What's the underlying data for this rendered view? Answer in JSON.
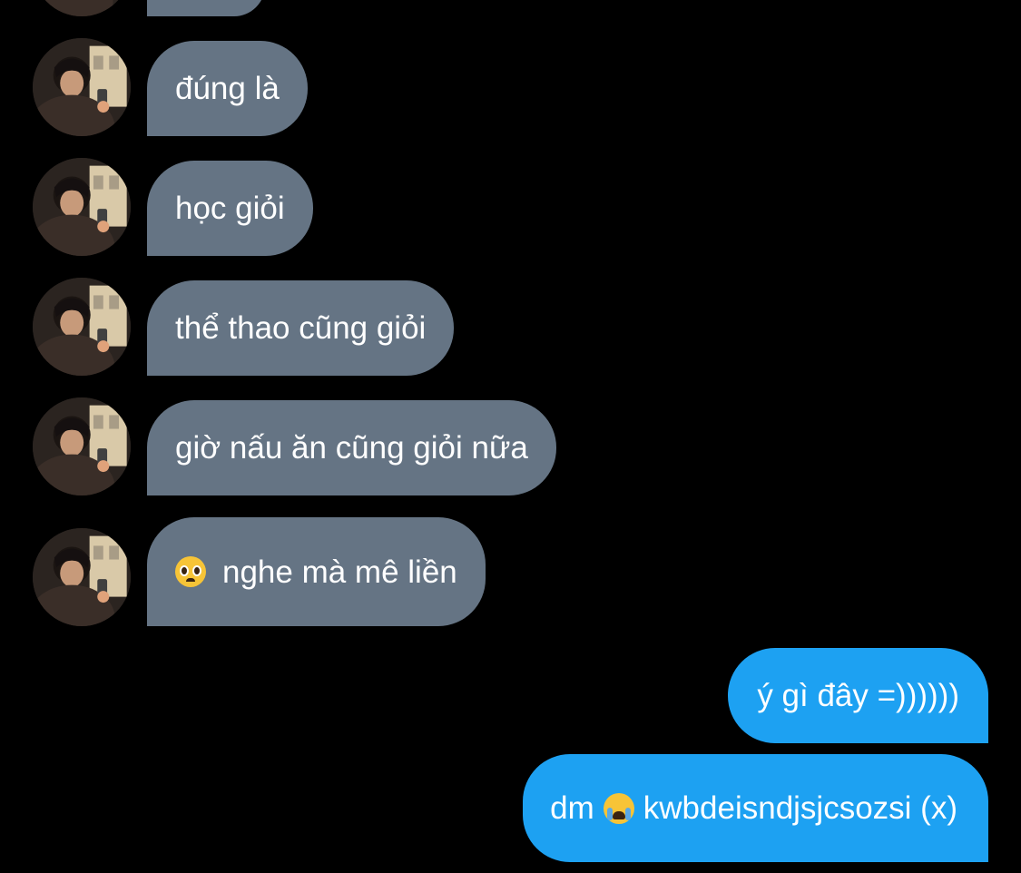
{
  "messages": [
    {
      "side": "incoming",
      "text": "đúng là"
    },
    {
      "side": "incoming",
      "text": "học giỏi"
    },
    {
      "side": "incoming",
      "text": "thể thao cũng giỏi"
    },
    {
      "side": "incoming",
      "text": "giờ nấu ăn cũng giỏi nữa"
    },
    {
      "side": "incoming",
      "emoji": "pleading-face",
      "text": "nghe mà mê liền"
    },
    {
      "side": "outgoing",
      "text": "ý gì đây =))))))"
    },
    {
      "side": "outgoing",
      "before": "dm",
      "emoji": "loudly-crying-face",
      "text": "kwbdeisndjsjcsozsi (x)"
    }
  ],
  "colors": {
    "background": "#000000",
    "incoming_bubble": "#657484",
    "outgoing_bubble": "#1da1f2",
    "text": "#ffffff"
  }
}
